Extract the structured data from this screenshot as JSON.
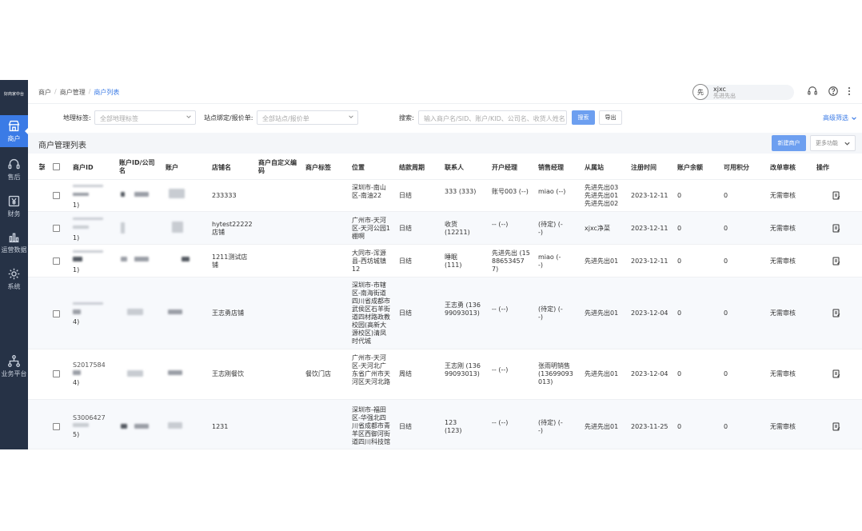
{
  "sidebar": {
    "logo": "好商家中台",
    "items": [
      {
        "label": "商户",
        "icon": "store-icon"
      },
      {
        "label": "售后",
        "icon": "headset-icon"
      },
      {
        "label": "财务",
        "icon": "yen-icon"
      },
      {
        "label": "运营数据",
        "icon": "bar-chart-icon"
      },
      {
        "label": "系统",
        "icon": "gear-icon"
      },
      {
        "label": "业务平台",
        "icon": "sitemap-icon"
      }
    ]
  },
  "topbar": {
    "breadcrumb": [
      "商户",
      "商户管理",
      "商户列表"
    ],
    "avatar_text": "先",
    "user_name": "xjxc",
    "user_sub": "先进先出"
  },
  "filters": {
    "geo_label": "地理标签:",
    "geo_placeholder": "全部地理标签",
    "site_label": "站点绑定/报价单:",
    "site_placeholder": "全部站点/报价单",
    "search_label": "搜索:",
    "search_placeholder": "输入商户名/SID、账户/KID、公司名、收货人姓名",
    "search_button": "搜索",
    "export_button": "导出",
    "advanced": "高级筛选"
  },
  "section": {
    "title": "商户管理列表",
    "new_button": "新建商户",
    "more_button": "更多功能"
  },
  "table": {
    "headers": [
      "商户ID",
      "账户ID/公司名",
      "账户",
      "店铺名",
      "商户自定义编码",
      "商户标签",
      "位置",
      "结款周期",
      "联系人",
      "开户经理",
      "销售经理",
      "从属站",
      "注册时间",
      "账户余额",
      "可用积分",
      "改单审核",
      "操作"
    ],
    "rows": [
      {
        "id_suffix": "1)",
        "store": "233333",
        "tag": "",
        "location": "深圳市-南山区-南油22",
        "cycle": "日结",
        "contact": "333 (333)",
        "open_mgr": "账号003 (--)",
        "sales_mgr": "miao (--)",
        "station": "先进先出03 先进先出01 先进先出02",
        "reg": "2023-12-11",
        "balance": "0",
        "points": "0",
        "audit": "无需审核"
      },
      {
        "id_suffix": "1)",
        "store": "hytest22222店铺",
        "tag": "",
        "location": "广州市-天河区-天河公园1棚啊",
        "cycle": "日结",
        "contact": "收货 (12211)",
        "open_mgr": "-- (--)",
        "sales_mgr": "(待定) (--)",
        "station": "xjxc净菜",
        "reg": "2023-12-11",
        "balance": "0",
        "points": "0",
        "audit": "无需审核"
      },
      {
        "id_suffix": "1)",
        "store": "1211测试店铺",
        "tag": "",
        "location": "大同市-浑源县-西坊城镇12",
        "cycle": "日结",
        "contact": "睡眠 (111)",
        "open_mgr": "先进先出 (15886534577)",
        "sales_mgr": "miao (--)",
        "station": "先进先出01",
        "reg": "2023-12-11",
        "balance": "0",
        "points": "0",
        "audit": "无需审核"
      },
      {
        "id_suffix": "4)",
        "store": "王志勇店铺",
        "tag": "",
        "location": "深圳市-市辖区-南海街道四川省成都市武侯区石羊街道四材路政教校园(高新大源校区)清凤时代城",
        "cycle": "日结",
        "contact": "王志勇 (13699093013)",
        "open_mgr": "-- (--)",
        "sales_mgr": "(待定) (--)",
        "station": "先进先出01",
        "reg": "2023-12-04",
        "balance": "0",
        "points": "0",
        "audit": "无需审核"
      },
      {
        "id_suffix": "4)",
        "id_prefix": "S2017584",
        "store": "王志刚餐饮",
        "tag": "餐饮门店",
        "location": "广州市-天河区-天河北广东省广州市天河区天河北路",
        "cycle": "周结",
        "contact": "王志刚 (13699093013)",
        "open_mgr": "-- (--)",
        "sales_mgr": "张雨明销售 (13699093013)",
        "station": "先进先出01",
        "reg": "2023-12-04",
        "balance": "0",
        "points": "0",
        "audit": "无需审核"
      },
      {
        "id_suffix": "5)",
        "id_prefix": "S3006427",
        "store": "1231",
        "tag": "",
        "location": "深圳市-福田区-华强北四川省成都市青羊区西御河街道四川科技馆",
        "cycle": "日结",
        "contact": "123 (123)",
        "open_mgr": "-- (--)",
        "sales_mgr": "(待定) (--)",
        "station": "先进先出01",
        "reg": "2023-11-25",
        "balance": "0",
        "points": "0",
        "audit": "无需审核"
      }
    ]
  },
  "colors": {
    "sidebar": "#263246",
    "accent": "#3b7be6",
    "button": "#6d9ff0"
  }
}
